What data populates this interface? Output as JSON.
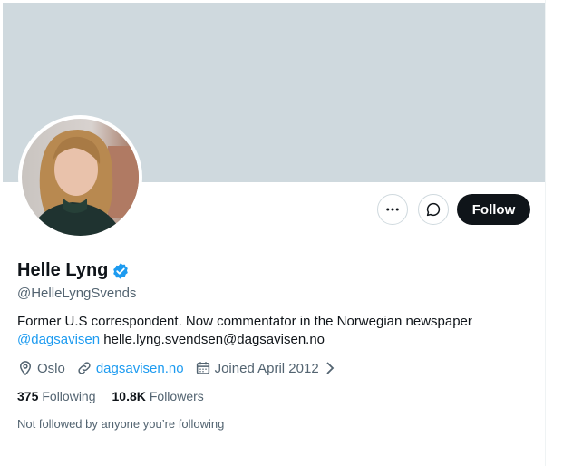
{
  "profile": {
    "name": "Helle Lyng",
    "handle": "@HelleLyngSvends",
    "bio_text": "Former U.S correspondent. Now commentator in the Norwegian newspaper",
    "bio_mention": "@dagsavisen",
    "bio_email": " helle.lyng.svendsen@dagsavisen.no",
    "location": "Oslo",
    "website": "dagsavisen.no",
    "joined": "Joined April 2012",
    "following_count": "375",
    "following_label": "Following",
    "followers_count": "10.8K",
    "followers_label": "Followers",
    "followed_note": "Not followed by anyone you’re following"
  },
  "actions": {
    "more_icon": "more-horizontal-icon",
    "message_icon": "message-icon",
    "follow_label": "Follow"
  },
  "colors": {
    "banner": "#cfd9de",
    "accent": "#1d9bf0",
    "primary_text": "#0f1419",
    "secondary_text": "#536471",
    "follow_button": "#0f1419"
  }
}
